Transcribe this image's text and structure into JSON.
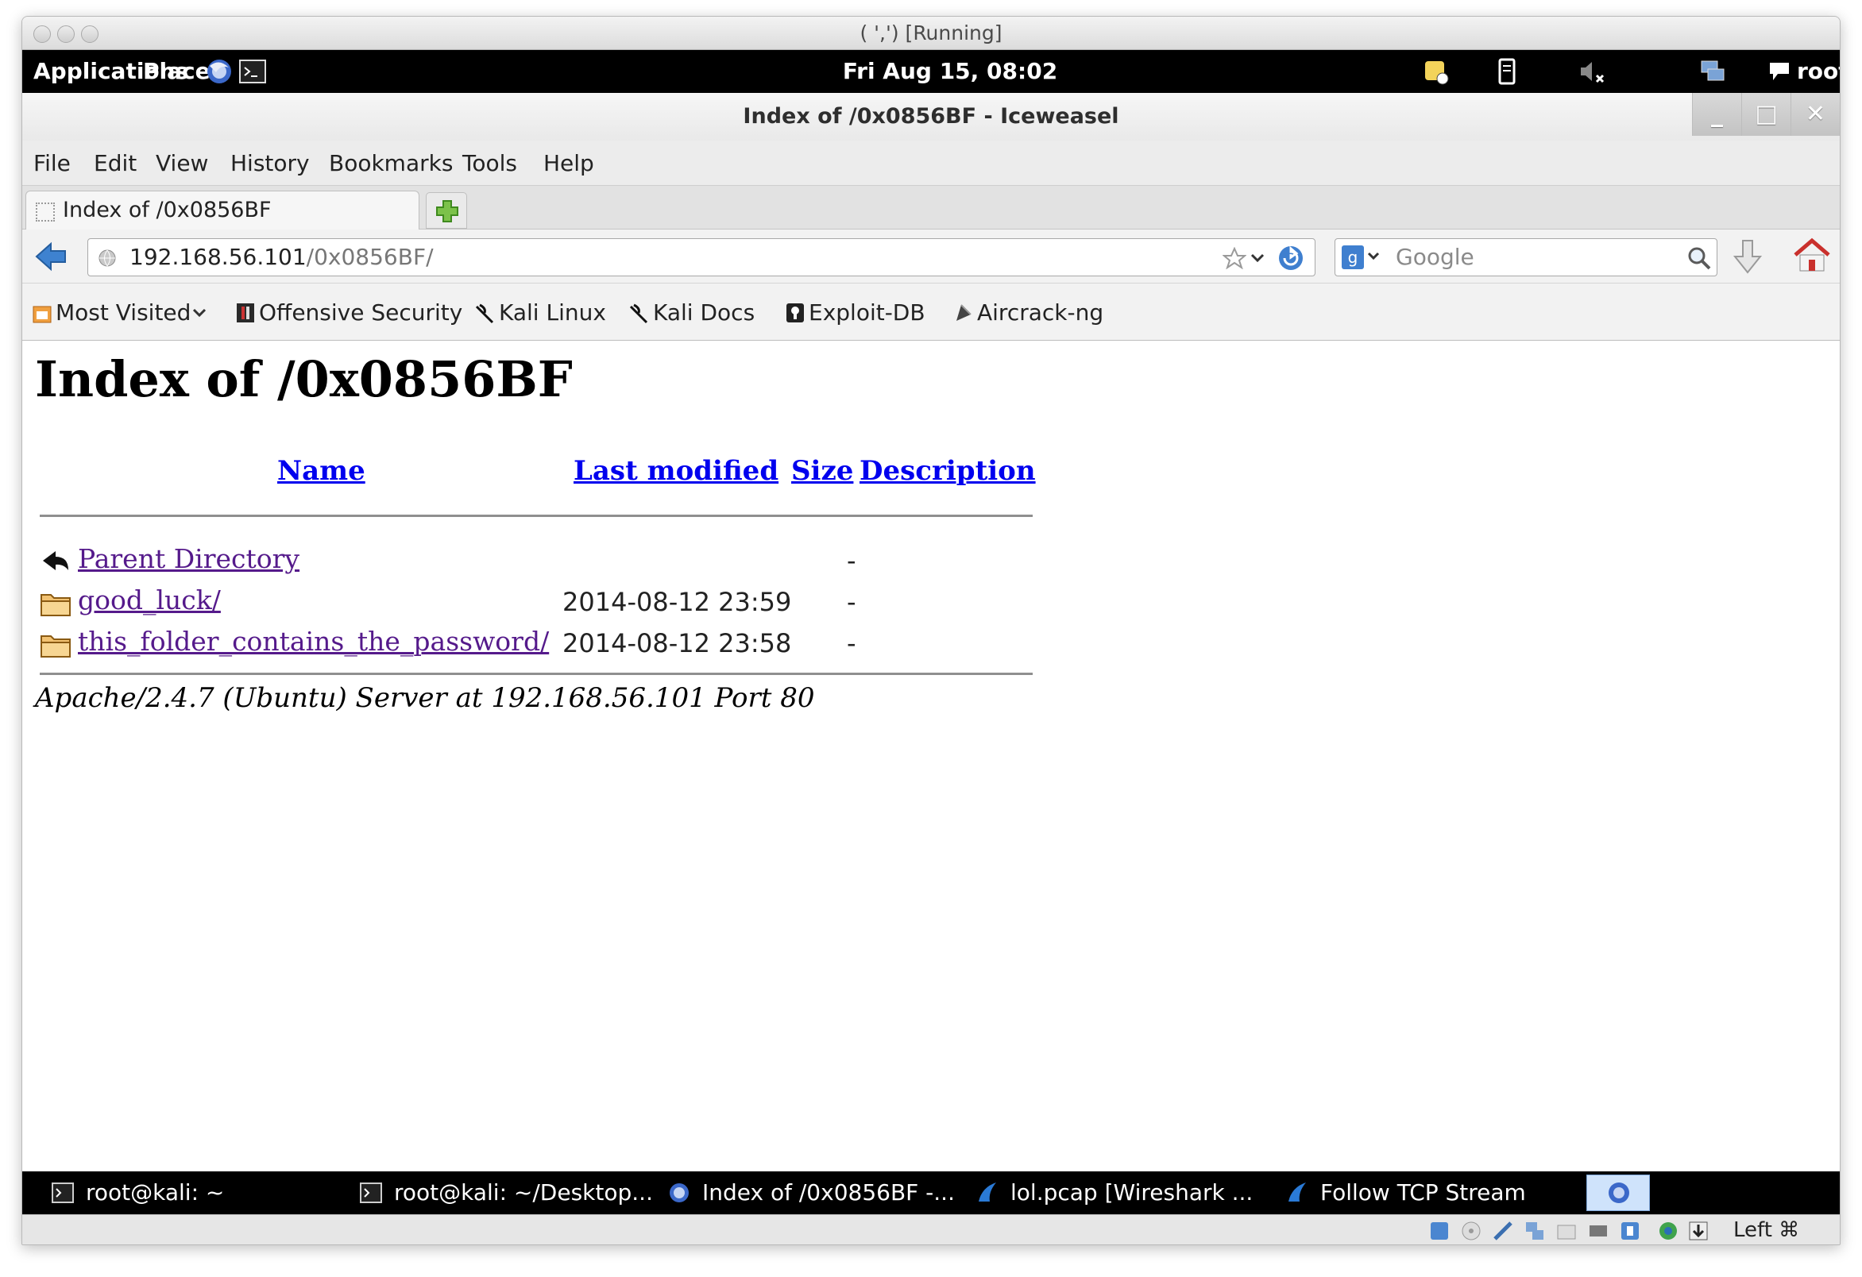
{
  "host_window": {
    "title": "( ',') [Running]"
  },
  "gnome_panel": {
    "applications": "Applications",
    "places": "Places",
    "clock": "Fri Aug 15, 08:02",
    "user": "root"
  },
  "browser": {
    "title": "Index of /0x0856BF - Iceweasel",
    "window_controls": {
      "minimize": "_",
      "maximize": "□",
      "close": "✕"
    },
    "menu": {
      "file": "File",
      "edit": "Edit",
      "view": "View",
      "history": "History",
      "bookmarks": "Bookmarks",
      "tools": "Tools",
      "help": "Help"
    },
    "tab": {
      "title": "Index of /0x0856BF"
    },
    "url": {
      "host": "192.168.56.101",
      "path": "/0x0856BF/"
    },
    "search": {
      "placeholder": "Google"
    },
    "bookmarks_bar": [
      {
        "label": "Most Visited",
        "icon": "most-visited-icon"
      },
      {
        "label": "Offensive Security",
        "icon": "offsec-icon"
      },
      {
        "label": "Kali Linux",
        "icon": "kali-icon"
      },
      {
        "label": "Kali Docs",
        "icon": "kali-icon"
      },
      {
        "label": "Exploit-DB",
        "icon": "exploitdb-icon"
      },
      {
        "label": "Aircrack-ng",
        "icon": "aircrack-icon"
      }
    ]
  },
  "page": {
    "heading": "Index of /0x0856BF",
    "columns": {
      "name": "Name",
      "last_modified": "Last modified",
      "size": "Size",
      "description": "Description"
    },
    "rows": [
      {
        "name": "Parent Directory",
        "modified": "",
        "size": "-",
        "icon": "back-arrow-icon"
      },
      {
        "name": "good_luck/",
        "modified": "2014-08-12 23:59",
        "size": "-",
        "icon": "folder-icon"
      },
      {
        "name": "this_folder_contains_the_password/",
        "modified": "2014-08-12 23:58",
        "size": "-",
        "icon": "folder-icon"
      }
    ],
    "footer": "Apache/2.4.7 (Ubuntu) Server at 192.168.56.101 Port 80"
  },
  "taskbar": [
    {
      "label": "root@kali: ~",
      "icon": "terminal-icon"
    },
    {
      "label": "root@kali: ~/Desktop...",
      "icon": "terminal-icon"
    },
    {
      "label": "Index of /0x0856BF -...",
      "icon": "iceweasel-icon"
    },
    {
      "label": "lol.pcap   [Wireshark ...",
      "icon": "wireshark-icon"
    },
    {
      "label": "Follow TCP Stream",
      "icon": "wireshark-icon"
    }
  ],
  "vbox_status": {
    "host_key": "Left ⌘"
  },
  "colors": {
    "link": "#0000ee",
    "visited": "#551a8b",
    "panel_bg": "#000000"
  }
}
